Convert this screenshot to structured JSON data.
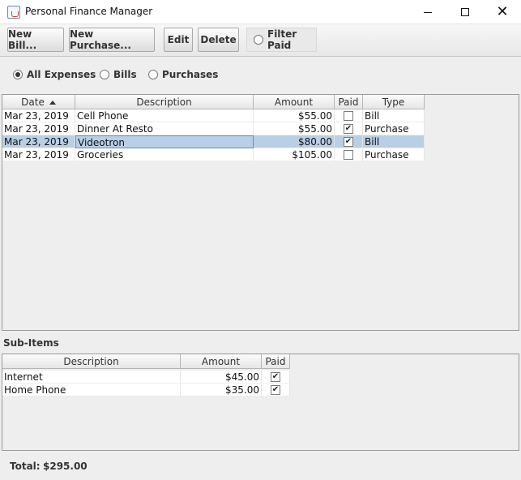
{
  "window": {
    "title": "Personal Finance Manager",
    "icon": "java-cup-icon"
  },
  "toolbar": {
    "new_bill": "New Bill...",
    "new_purchase": "New Purchase...",
    "edit": "Edit",
    "delete": "Delete",
    "filter_paid": "Filter Paid",
    "filter_paid_checked": false
  },
  "filters": {
    "all_expenses": "All Expenses",
    "bills": "Bills",
    "purchases": "Purchases",
    "selected": "All Expenses"
  },
  "expenses": {
    "columns": [
      "Date",
      "Description",
      "Amount",
      "Paid",
      "Type"
    ],
    "sort_column": "Date",
    "sort_direction": "ascending",
    "selected_row": 2,
    "rows": [
      {
        "date": "Mar 23, 2019",
        "description": "Cell Phone",
        "amount": "$55.00",
        "paid": false,
        "type": "Bill"
      },
      {
        "date": "Mar 23, 2019",
        "description": "Dinner At Resto",
        "amount": "$55.00",
        "paid": true,
        "type": "Purchase"
      },
      {
        "date": "Mar 23, 2019",
        "description": "Videotron",
        "amount": "$80.00",
        "paid": true,
        "type": "Bill"
      },
      {
        "date": "Mar 23, 2019",
        "description": "Groceries",
        "amount": "$105.00",
        "paid": false,
        "type": "Purchase"
      }
    ]
  },
  "sub_items": {
    "label": "Sub-Items",
    "columns": [
      "Description",
      "Amount",
      "Paid"
    ],
    "rows": [
      {
        "description": "Internet",
        "amount": "$45.00",
        "paid": true
      },
      {
        "description": "Home Phone",
        "amount": "$35.00",
        "paid": true
      }
    ]
  },
  "total": {
    "label": "Total:",
    "value": "$295.00"
  },
  "colors": {
    "selection": "#b8cfe5",
    "window_bg": "#eeeeee"
  }
}
